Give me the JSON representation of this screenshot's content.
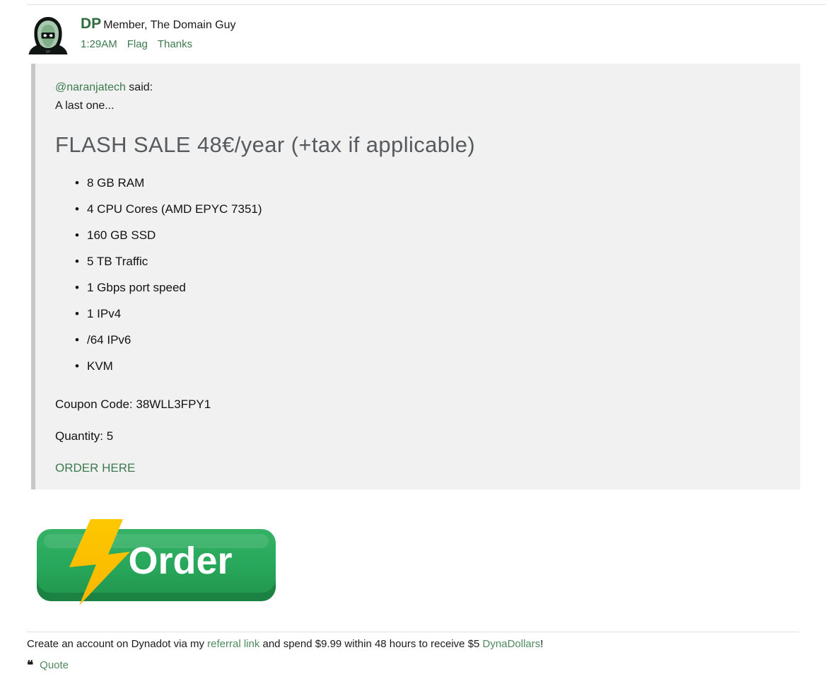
{
  "post": {
    "avatar_icon": "hooded-figure-avatar",
    "username": "DP",
    "user_title": "Member, The Domain Guy",
    "timestamp": "1:29AM",
    "flag_label": "Flag",
    "thanks_label": "Thanks"
  },
  "quote": {
    "attrib_user": "@naranjatech",
    "attrib_suffix": " said:",
    "lead": "A last one...",
    "heading": "FLASH SALE 48€/year (+tax if applicable)",
    "specs": [
      "8 GB RAM",
      "4 CPU Cores (AMD EPYC 7351)",
      "160 GB SSD",
      "5 TB Traffic",
      "1 Gbps port speed",
      "1 IPv4",
      "/64 IPv6",
      "KVM"
    ],
    "coupon_line": "Coupon Code: 38WLL3FPY1",
    "quantity_line": "Quantity: 5",
    "order_link_label": "ORDER HERE"
  },
  "order_button": {
    "label": "Order",
    "icon": "lightning-bolt-icon",
    "green": "#2aa85c",
    "green_dark": "#1e8c4a",
    "yellow": "#fbbf00"
  },
  "signature": {
    "part1": "Create an account on Dynadot via my ",
    "link1": "referral link",
    "part2": " and spend $9.99 within 48 hours to receive $5 ",
    "link2": "DynaDollars",
    "part3": "!"
  },
  "actions": {
    "quote_icon": "❝",
    "quote_label": "Quote"
  },
  "colors": {
    "link_green": "#3c7a4e",
    "username_green": "#2f6b3c",
    "quote_bg": "#f1f1f1",
    "quote_border": "#c7c7c7",
    "heading_gray": "#585b5e"
  }
}
